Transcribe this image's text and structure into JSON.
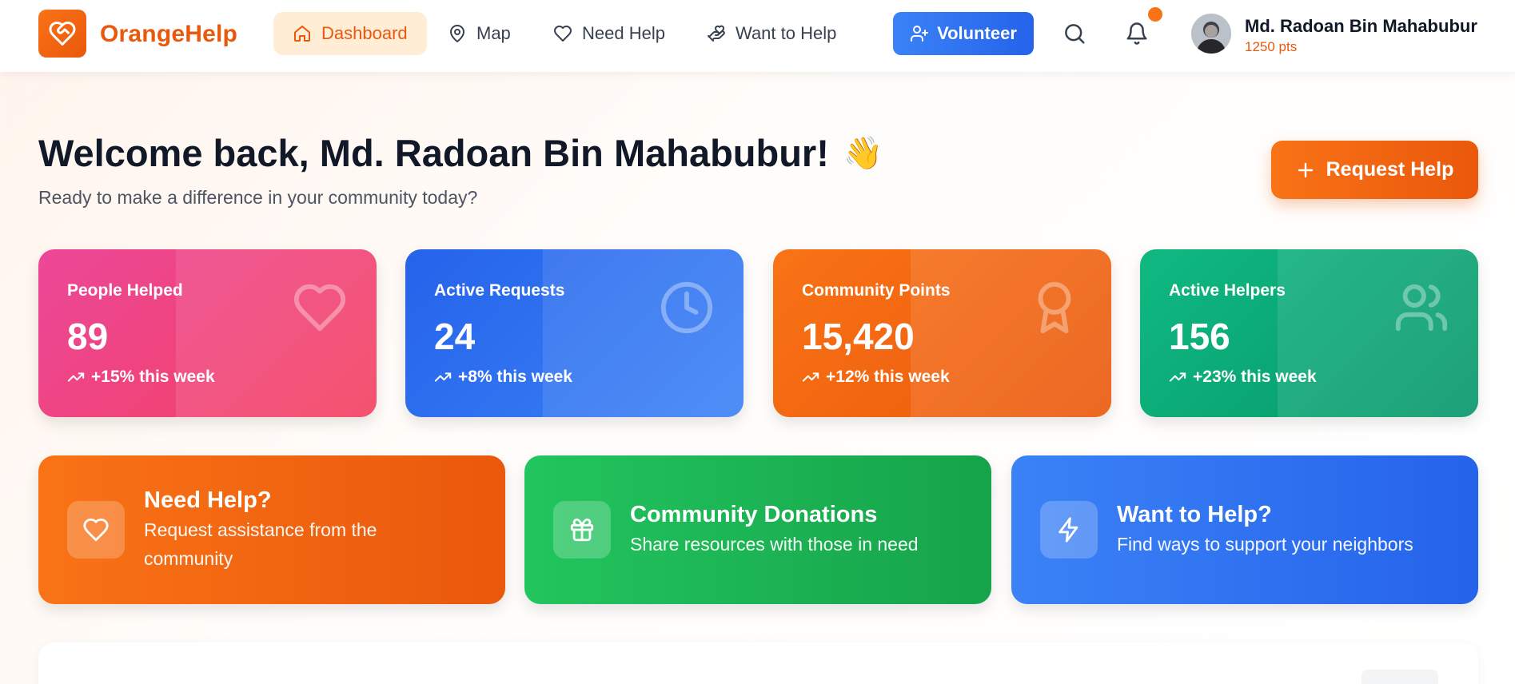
{
  "brand": {
    "name": "OrangeHelp",
    "logo_icon": "heart-handshake-icon"
  },
  "nav": {
    "items": [
      {
        "label": "Dashboard",
        "icon": "home-icon",
        "active": true
      },
      {
        "label": "Map",
        "icon": "map-pin-icon",
        "active": false
      },
      {
        "label": "Need Help",
        "icon": "heart-icon",
        "active": false
      },
      {
        "label": "Want to Help",
        "icon": "hand-heart-icon",
        "active": false
      }
    ],
    "volunteer_label": "Volunteer"
  },
  "user": {
    "name": "Md. Radoan Bin Mahabubur",
    "points": "1250 pts"
  },
  "welcome": {
    "title": "Welcome back, Md. Radoan Bin Mahabubur!",
    "emoji": "👋",
    "subtitle": "Ready to make a difference in your community today?",
    "request_label": "Request Help"
  },
  "stats": [
    {
      "label": "People Helped",
      "value": "89",
      "trend": "+15% this week",
      "icon": "heart-icon",
      "color": "#ec4899"
    },
    {
      "label": "Active Requests",
      "value": "24",
      "trend": "+8% this week",
      "icon": "clock-icon",
      "color": "#3b82f6"
    },
    {
      "label": "Community Points",
      "value": "15,420",
      "trend": "+12% this week",
      "icon": "award-icon",
      "color": "#f97316"
    },
    {
      "label": "Active Helpers",
      "value": "156",
      "trend": "+23% this week",
      "icon": "users-icon",
      "color": "#10b981"
    }
  ],
  "actions": [
    {
      "title": "Need Help?",
      "description": "Request assistance from the community",
      "icon": "heart-icon",
      "color": "#f97316"
    },
    {
      "title": "Community Donations",
      "description": "Share resources with those in need",
      "icon": "gift-icon",
      "color": "#22c55e"
    },
    {
      "title": "Want to Help?",
      "description": "Find ways to support your neighbors",
      "icon": "zap-icon",
      "color": "#3b82f6"
    }
  ]
}
